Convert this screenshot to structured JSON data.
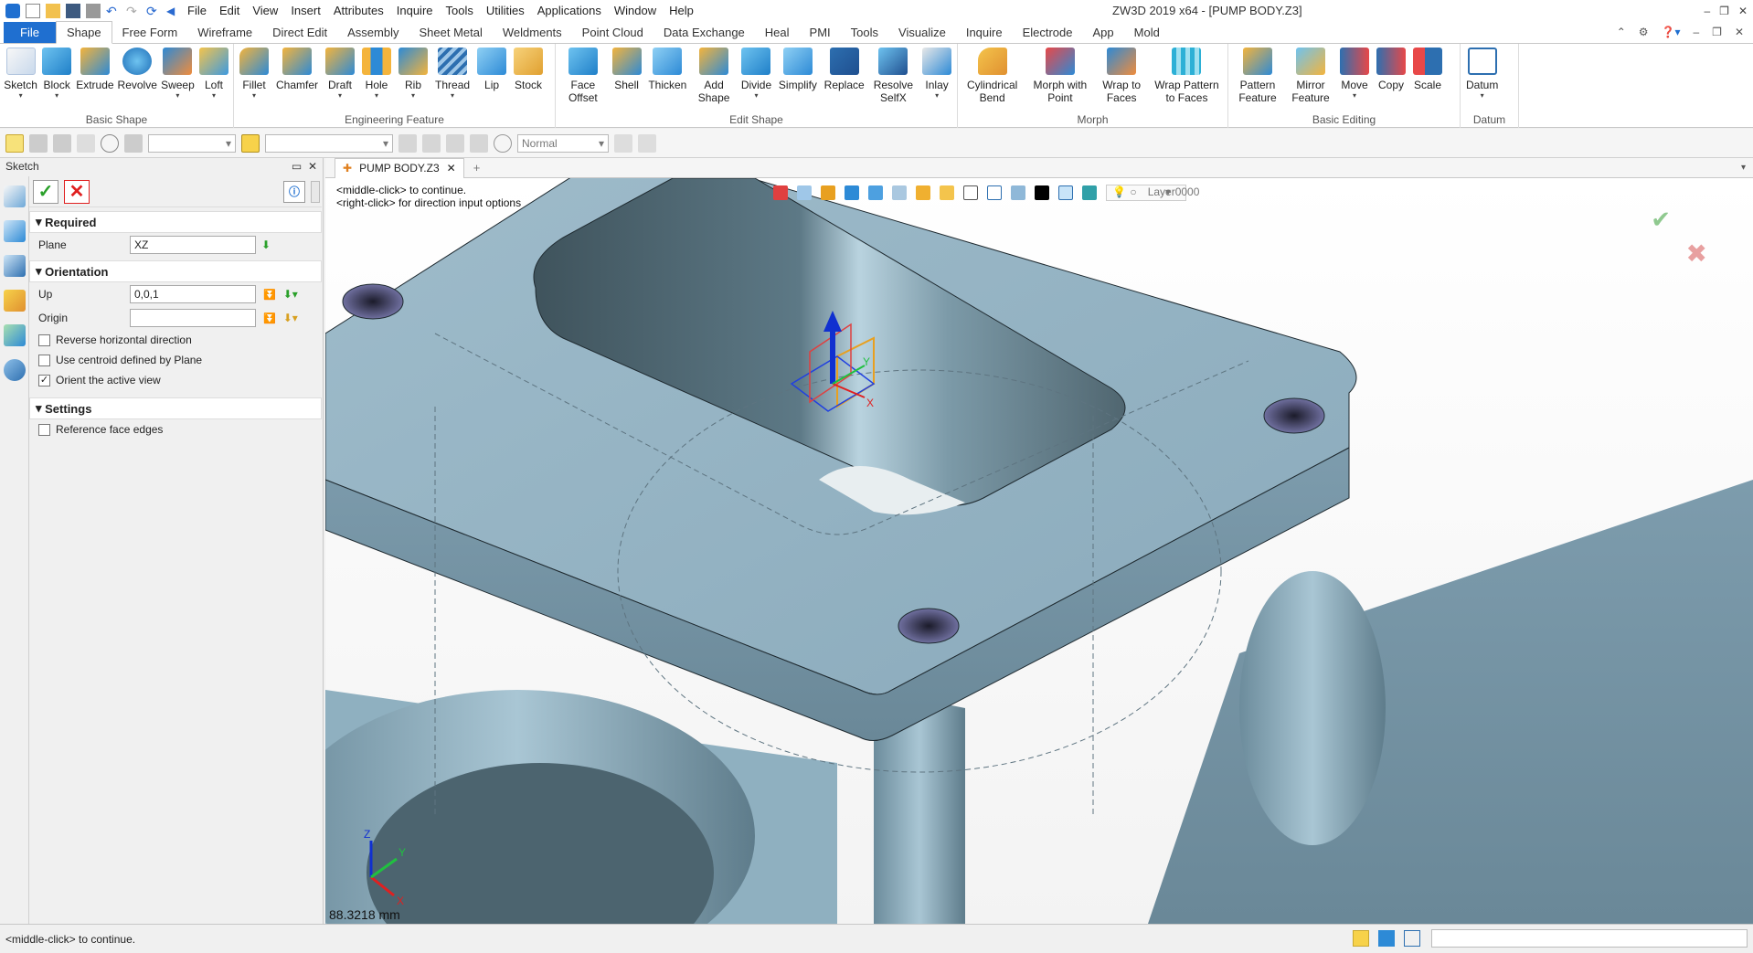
{
  "menu": {
    "items": [
      "File",
      "Edit",
      "View",
      "Insert",
      "Attributes",
      "Inquire",
      "Tools",
      "Utilities",
      "Applications",
      "Window",
      "Help"
    ],
    "window_title": "ZW3D 2019  x64 - [PUMP BODY.Z3]"
  },
  "tabs": [
    "File",
    "Shape",
    "Free Form",
    "Wireframe",
    "Direct Edit",
    "Assembly",
    "Sheet Metal",
    "Weldments",
    "Point Cloud",
    "Data Exchange",
    "Heal",
    "PMI",
    "Tools",
    "Visualize",
    "Inquire",
    "Electrode",
    "App",
    "Mold"
  ],
  "ribbon": {
    "basic_shape": {
      "label": "Basic Shape",
      "buttons": [
        "Sketch",
        "Block",
        "Extrude",
        "Revolve",
        "Sweep",
        "Loft"
      ]
    },
    "engineering_feature": {
      "label": "Engineering Feature",
      "buttons": [
        "Fillet",
        "Chamfer",
        "Draft",
        "Hole",
        "Rib",
        "Thread",
        "Lip",
        "Stock"
      ]
    },
    "edit_shape": {
      "label": "Edit Shape",
      "buttons": [
        "Face Offset",
        "Shell",
        "Thicken",
        "Add Shape",
        "Divide",
        "Simplify",
        "Replace",
        "Resolve SelfX",
        "Inlay"
      ]
    },
    "morph": {
      "label": "Morph",
      "buttons": [
        "Cylindrical Bend",
        "Morph with Point",
        "Wrap to Faces",
        "Wrap Pattern to Faces"
      ]
    },
    "basic_editing": {
      "label": "Basic Editing",
      "buttons": [
        "Pattern Feature",
        "Mirror Feature",
        "Move",
        "Copy",
        "Scale"
      ]
    },
    "datum": {
      "label": "Datum",
      "buttons": [
        "Datum"
      ]
    }
  },
  "toolbar2": {
    "filter_value": "",
    "render_mode": "Normal"
  },
  "panel": {
    "title": "Sketch",
    "required": "Required",
    "plane_label": "Plane",
    "plane_value": "XZ",
    "orientation": "Orientation",
    "up_label": "Up",
    "up_value": "0,0,1",
    "origin_label": "Origin",
    "origin_value": "",
    "checks": [
      {
        "label": "Reverse horizontal direction",
        "checked": false
      },
      {
        "label": "Use centroid defined by Plane",
        "checked": false
      },
      {
        "label": "Orient the active view",
        "checked": true
      }
    ],
    "settings": "Settings",
    "settings_checks": [
      {
        "label": "Reference face edges",
        "checked": false
      }
    ]
  },
  "viewport": {
    "doc_tab": "PUMP BODY.Z3",
    "hint1": "<middle-click> to continue.",
    "hint2": "<right-click> for direction input options",
    "layer": "Layer0000",
    "measure": "88.3218 mm"
  },
  "status": {
    "message": "<middle-click> to continue."
  },
  "colors": {
    "file_tab": "#1f6fd0",
    "part_face": "#8fb2c4",
    "part_dark": "#4e6670"
  }
}
